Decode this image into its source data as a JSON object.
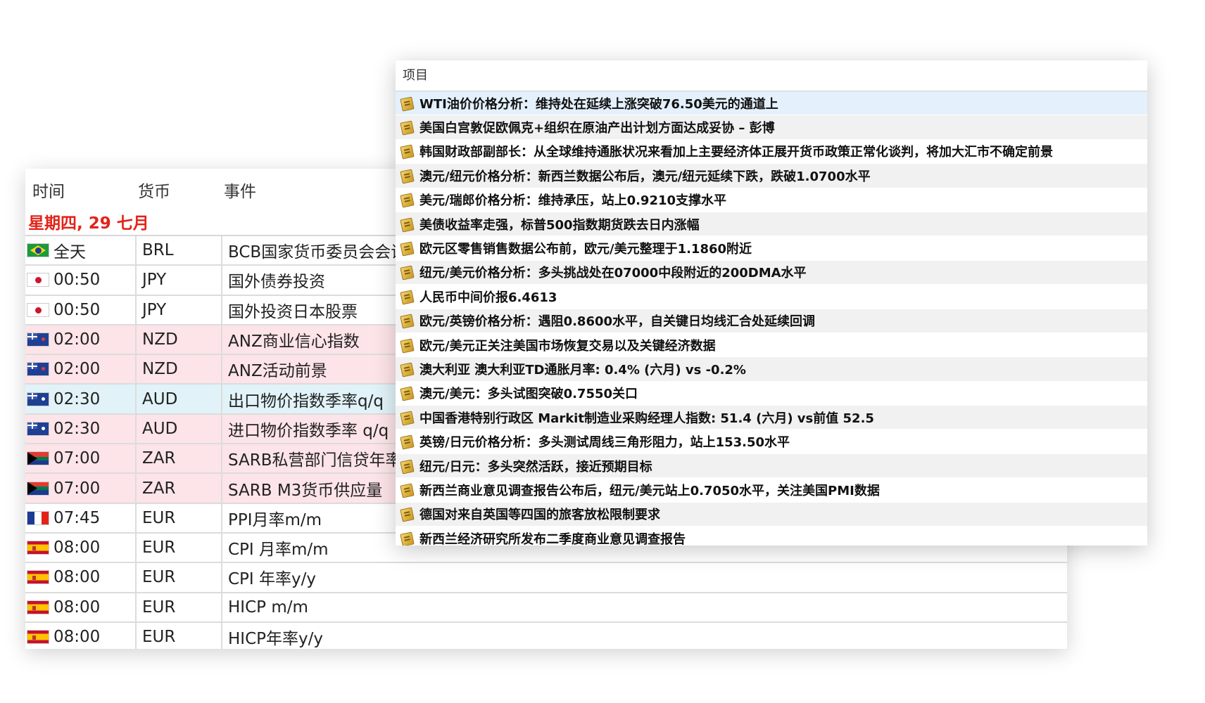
{
  "calendar": {
    "columns": {
      "time": "时间",
      "currency": "货币",
      "event": "事件"
    },
    "date": "星期四, 29 七月",
    "rows": [
      {
        "flag": "BR",
        "time": "全天",
        "currency": "BRL",
        "event": "BCB国家货币委员会会议"
      },
      {
        "flag": "JP",
        "time": "00:50",
        "currency": "JPY",
        "event": "国外债券投资"
      },
      {
        "flag": "JP",
        "time": "00:50",
        "currency": "JPY",
        "event": "国外投资日本股票"
      },
      {
        "flag": "NZ",
        "time": "02:00",
        "currency": "NZD",
        "event": "ANZ商业信心指数"
      },
      {
        "flag": "NZ",
        "time": "02:00",
        "currency": "NZD",
        "event": "ANZ活动前景"
      },
      {
        "flag": "AU",
        "time": "02:30",
        "currency": "AUD",
        "event": "出口物价指数季率q/q"
      },
      {
        "flag": "AU",
        "time": "02:30",
        "currency": "AUD",
        "event": "进口物价指数季率 q/q"
      },
      {
        "flag": "ZA",
        "time": "07:00",
        "currency": "ZAR",
        "event": "SARB私营部门信贷年率"
      },
      {
        "flag": "ZA",
        "time": "07:00",
        "currency": "ZAR",
        "event": "SARB M3货币供应量"
      },
      {
        "flag": "FR",
        "time": "07:45",
        "currency": "EUR",
        "event": "PPI月率m/m"
      },
      {
        "flag": "ES",
        "time": "08:00",
        "currency": "EUR",
        "event": "CPI 月率m/m"
      },
      {
        "flag": "ES",
        "time": "08:00",
        "currency": "EUR",
        "event": "CPI 年率y/y"
      },
      {
        "flag": "ES",
        "time": "08:00",
        "currency": "EUR",
        "event": "HICP m/m"
      },
      {
        "flag": "ES",
        "time": "08:00",
        "currency": "EUR",
        "event": "HICP年率y/y"
      }
    ]
  },
  "news": {
    "header": "项目",
    "items": [
      "WTI油价价格分析：维持处在延续上涨突破76.50美元的通道上",
      "美国白宫敦促欧佩克+组织在原油产出计划方面达成妥协 – 彭博",
      "韩国财政部副部长：从全球维持通胀状况来看加上主要经济体正展开货币政策正常化谈判，将加大汇市不确定前景",
      "澳元/纽元价格分析：新西兰数据公布后，澳元/纽元延续下跌，跌破1.0700水平",
      "美元/瑞郎价格分析：维持承压，站上0.9210支撑水平",
      "美债收益率走强，标普500指数期货跌去日内涨幅",
      "欧元区零售销售数据公布前，欧元/美元整理于1.1860附近",
      "纽元/美元价格分析：多头挑战处在07000中段附近的200DMA水平",
      "人民币中间价报6.4613",
      "欧元/英镑价格分析：遇阻0.8600水平，自关键日均线汇合处延续回调",
      "欧元/美元正关注美国市场恢复交易以及关键经济数据",
      "澳大利亚 澳大利亚TD通胀月率: 0.4% (六月) vs -0.2%",
      "澳元/美元：多头试图突破0.7550关口",
      "中国香港特别行政区 Markit制造业采购经理人指数: 51.4 (六月) vs前值 52.5",
      "英镑/日元价格分析：多头测试周线三角形阻力，站上153.50水平",
      "纽元/日元：多头突然活跃，接近预期目标",
      "新西兰商业意见调查报告公布后，纽元/美元站上0.7050水平，关注美国PMI数据",
      "德国对来自英国等四国的旅客放松限制要求",
      "新西兰经济研究所发布二季度商业意见调查报告"
    ]
  }
}
